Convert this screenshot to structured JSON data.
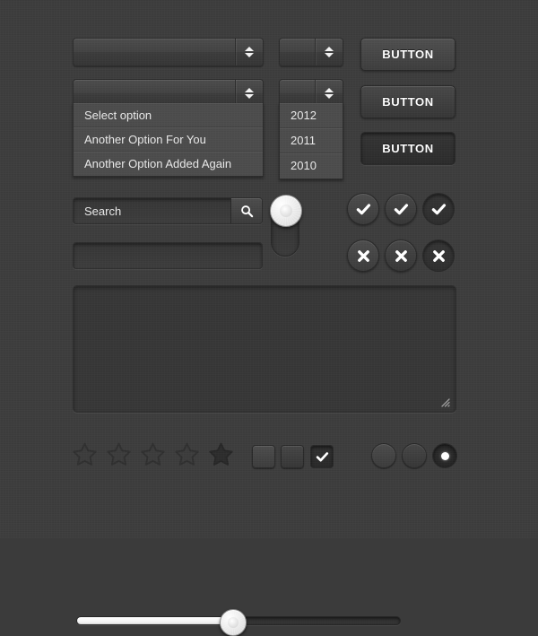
{
  "theme": {
    "background": "#3b3b3b",
    "panel": "#353535",
    "border": "#2a2a2a",
    "text": "#e9e9e9",
    "accent_white": "#ffffff"
  },
  "selects": {
    "wide_closed": {
      "name": "select-wide",
      "value": "",
      "arrow_icon": "spinner-updown-icon"
    },
    "wide_open": {
      "name": "select-wide-open",
      "value": "",
      "arrow_icon": "spinner-updown-icon"
    },
    "small_closed": {
      "name": "select-small",
      "value": "",
      "arrow_icon": "spinner-updown-icon"
    },
    "small_open": {
      "name": "select-small-open",
      "value": "",
      "arrow_icon": "spinner-updown-icon"
    },
    "options": [
      {
        "label": "Select option"
      },
      {
        "label": "Another Option For You"
      },
      {
        "label": "Another Option Added Again"
      }
    ],
    "year_options": [
      {
        "label": "2012"
      },
      {
        "label": "2011"
      },
      {
        "label": "2010"
      }
    ]
  },
  "buttons": [
    {
      "label": "BUTTON",
      "state": "normal"
    },
    {
      "label": "BUTTON",
      "state": "hover"
    },
    {
      "label": "BUTTON",
      "state": "pressed"
    }
  ],
  "search": {
    "value": "Search",
    "placeholder": "Search",
    "icon": "search-icon"
  },
  "text_input": {
    "value": "",
    "placeholder": ""
  },
  "textarea": {
    "value": "",
    "placeholder": "",
    "resize_grip_icon": "resize-grip-icon"
  },
  "toggle": {
    "name": "toggle-switch-vertical",
    "state": "on",
    "knob_icon": "metal-knob-icon"
  },
  "icon_buttons": {
    "check_row": [
      {
        "icon": "check-icon",
        "state": "normal"
      },
      {
        "icon": "check-icon",
        "state": "hover"
      },
      {
        "icon": "check-icon",
        "state": "pressed"
      }
    ],
    "cross_row": [
      {
        "icon": "cross-icon",
        "state": "normal"
      },
      {
        "icon": "cross-icon",
        "state": "hover"
      },
      {
        "icon": "cross-icon",
        "state": "pressed"
      }
    ]
  },
  "rating": {
    "max": 5,
    "value": 1,
    "filled_index": 4,
    "stars": [
      {
        "filled": false
      },
      {
        "filled": false
      },
      {
        "filled": false
      },
      {
        "filled": false
      },
      {
        "filled": true
      }
    ]
  },
  "checkboxes": [
    {
      "checked": false,
      "state": "normal"
    },
    {
      "checked": false,
      "state": "hover"
    },
    {
      "checked": true,
      "state": "checked",
      "icon": "check-icon"
    }
  ],
  "radios": [
    {
      "selected": false,
      "state": "normal"
    },
    {
      "selected": false,
      "state": "hover"
    },
    {
      "selected": true,
      "state": "selected"
    }
  ],
  "slider": {
    "name": "range-slider",
    "value": 48,
    "min": 0,
    "max": 100,
    "fill_percent": "48%"
  }
}
